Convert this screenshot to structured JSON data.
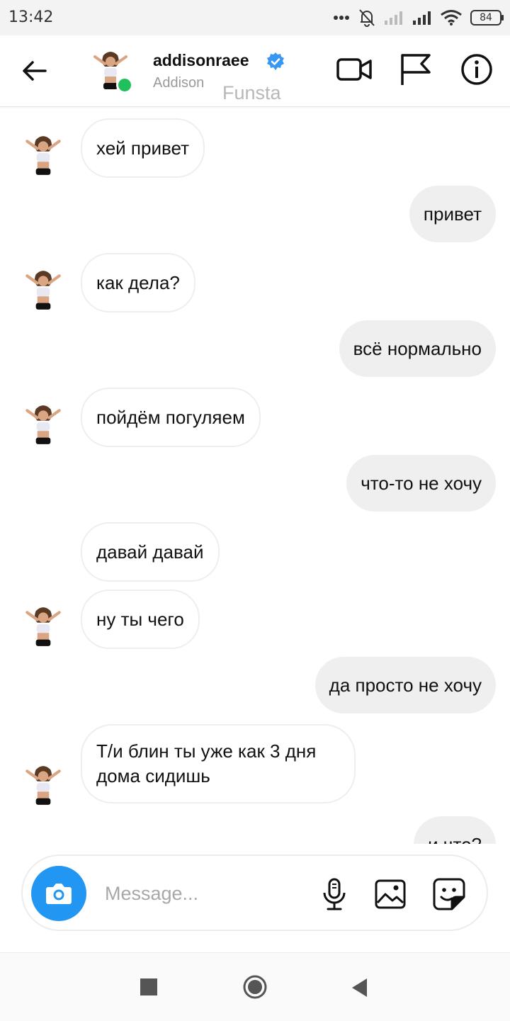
{
  "status_bar": {
    "time": "13:42",
    "battery": "84"
  },
  "header": {
    "username": "addisonraee",
    "display_name": "Addison",
    "watermark": "Funsta",
    "verified_color": "#3897f0",
    "online_color": "#20c05c"
  },
  "messages": [
    {
      "side": "in",
      "text": "хей привет",
      "avatar": true
    },
    {
      "side": "out",
      "text": "привет"
    },
    {
      "side": "in",
      "text": "как дела?",
      "avatar": true
    },
    {
      "side": "out",
      "text": "всё нормально"
    },
    {
      "side": "in",
      "text": "пойдём погуляем",
      "avatar": true
    },
    {
      "side": "out",
      "text": "что-то не хочу"
    },
    {
      "side": "in",
      "text": "давай давай",
      "avatar": false
    },
    {
      "side": "in",
      "text": "ну ты чего",
      "avatar": true
    },
    {
      "side": "out",
      "text": "да просто не хочу"
    },
    {
      "side": "in",
      "text": "Т/и блин ты уже как 3 дня дома сидишь",
      "avatar": true
    },
    {
      "side": "out",
      "text": "и что?"
    }
  ],
  "composer": {
    "placeholder": "Message...",
    "camera_color": "#2196f3"
  },
  "icons": {
    "back": "arrow-left-icon",
    "video": "video-camera-icon",
    "flag": "flag-icon",
    "info": "info-icon",
    "camera": "camera-icon",
    "mic": "microphone-icon",
    "gallery": "gallery-icon",
    "sticker": "sticker-icon"
  }
}
